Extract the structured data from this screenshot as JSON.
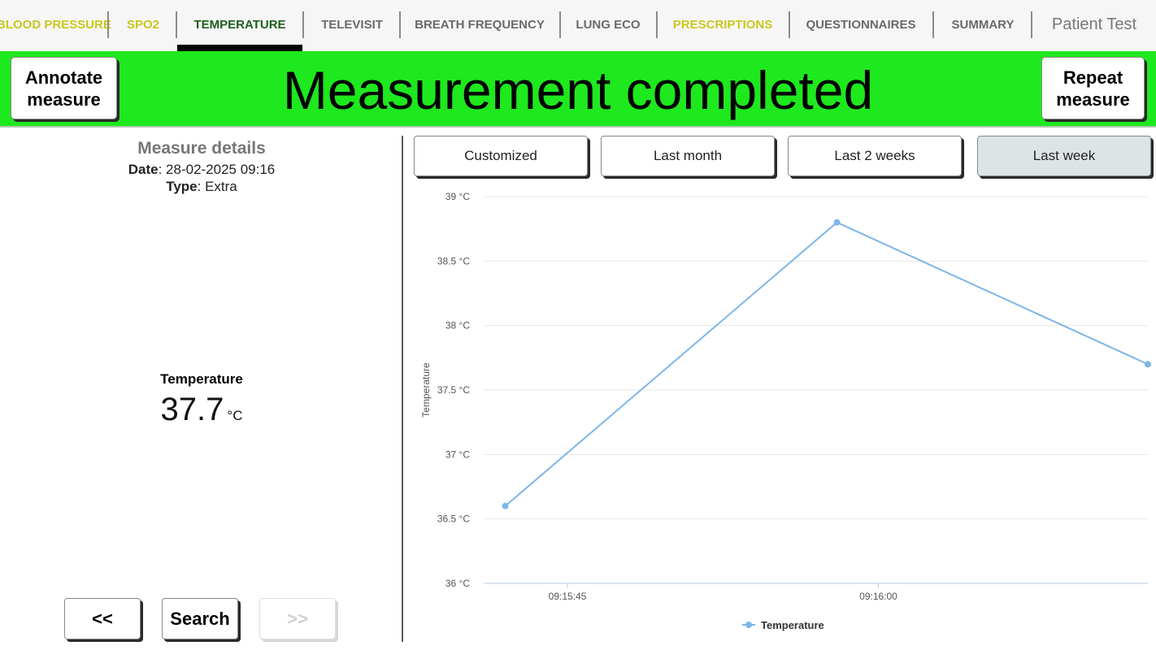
{
  "tabs": [
    {
      "label": "BLOOD PRESSURE",
      "style": "yellow"
    },
    {
      "label": "SPO2",
      "style": "yellow"
    },
    {
      "label": "TEMPERATURE",
      "style": "active"
    },
    {
      "label": "TELEVISIT",
      "style": "normal"
    },
    {
      "label": "BREATH FREQUENCY",
      "style": "normal"
    },
    {
      "label": "LUNG ECO",
      "style": "normal"
    },
    {
      "label": "PRESCRIPTIONS",
      "style": "yellow"
    },
    {
      "label": "QUESTIONNAIRES",
      "style": "normal"
    },
    {
      "label": "SUMMARY",
      "style": "normal"
    }
  ],
  "patient_name": "Patient Test",
  "banner": {
    "title": "Measurement completed",
    "annotate_label_1": "Annotate",
    "annotate_label_2": "measure",
    "repeat_label_1": "Repeat",
    "repeat_label_2": "measure",
    "color": "#1ee81e"
  },
  "details": {
    "title": "Measure details",
    "date_label": "Date",
    "date_value": ": 28-02-2025 09:16",
    "type_label": "Type",
    "type_value": ": Extra"
  },
  "metric": {
    "label": "Temperature",
    "value": "37.7",
    "unit": "°C"
  },
  "navigation": {
    "prev_label": "<<",
    "search_label": "Search",
    "next_label": ">>"
  },
  "ranges": [
    {
      "label": "Customized",
      "selected": false
    },
    {
      "label": "Last month",
      "selected": false
    },
    {
      "label": "Last 2 weeks",
      "selected": false
    },
    {
      "label": "Last week",
      "selected": true
    }
  ],
  "chart_data": {
    "type": "line",
    "title": "",
    "xlabel": "",
    "ylabel": "Temperature",
    "ylim": [
      36,
      39
    ],
    "yticks": [
      36,
      36.5,
      37,
      37.5,
      38,
      38.5,
      39
    ],
    "ytick_suffix": " °C",
    "xlim": [
      "09:15:41",
      "09:16:13"
    ],
    "xticks": [
      "09:15:45",
      "09:16:00"
    ],
    "grid": true,
    "legend": "bottom",
    "series": [
      {
        "name": "Temperature",
        "color": "#7fb6e8",
        "points": [
          {
            "x": "09:15:42",
            "y": 36.6
          },
          {
            "x": "09:15:58",
            "y": 38.8
          },
          {
            "x": "09:16:13",
            "y": 37.7
          }
        ]
      }
    ]
  }
}
